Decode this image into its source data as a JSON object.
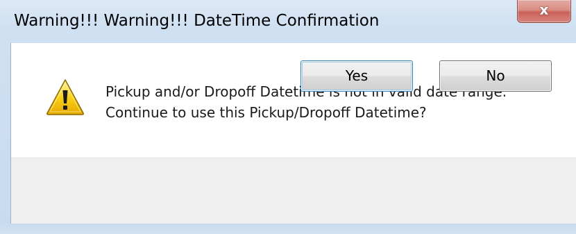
{
  "window": {
    "title": "Warning!!! Warning!!! DateTime Confirmation",
    "close_glyph": "x"
  },
  "message": {
    "line1": "Pickup and/or Dropoff Datetime is not in valid date range.",
    "line2": "Continue to use this Pickup/Dropoff Datetime?",
    "icon": "warning-icon"
  },
  "buttons": {
    "yes_label": "Yes",
    "no_label": "No"
  },
  "colors": {
    "frame": "#cfe0f2",
    "close_button": "#c9615a",
    "warning_fill": "#f5c400",
    "default_button_border": "#3c7fb1"
  }
}
